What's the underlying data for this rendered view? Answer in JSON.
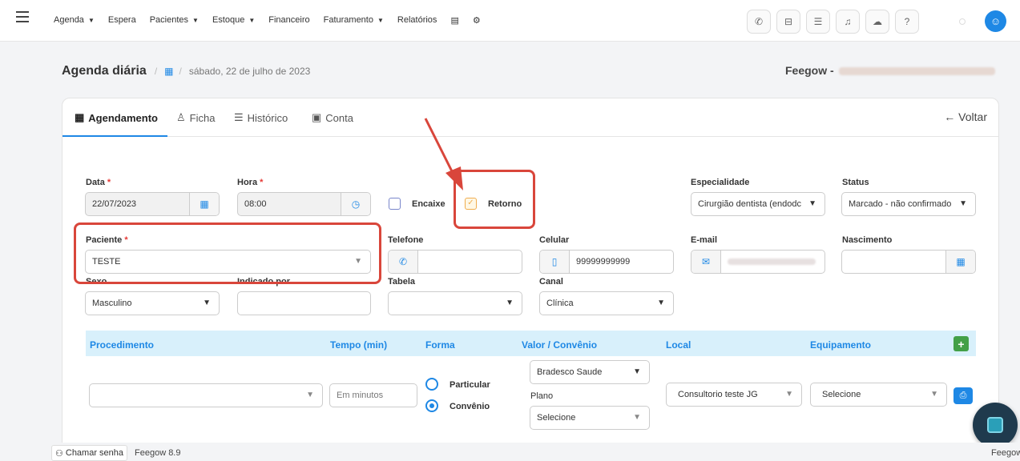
{
  "nav": {
    "items": [
      {
        "label": "Agenda",
        "caret": true
      },
      {
        "label": "Espera",
        "caret": false
      },
      {
        "label": "Pacientes",
        "caret": true
      },
      {
        "label": "Estoque",
        "caret": true
      },
      {
        "label": "Financeiro",
        "caret": false
      },
      {
        "label": "Faturamento",
        "caret": true
      },
      {
        "label": "Relatórios",
        "caret": false
      }
    ],
    "icons": [
      "database-icon",
      "gear-icon",
      "phone-icon",
      "inbox-icon",
      "checklist-icon",
      "bell-icon",
      "chat-icon",
      "help-icon",
      "user-icon"
    ]
  },
  "page": {
    "title": "Agenda diária",
    "date": "sábado, 22 de julho de 2023",
    "brand": "Feegow -"
  },
  "tabs": {
    "agendamento": "Agendamento",
    "ficha": "Ficha",
    "historico": "Histórico",
    "conta": "Conta",
    "voltar": "← Voltar"
  },
  "form": {
    "data_label": "Data",
    "data_value": "22/07/2023",
    "hora_label": "Hora",
    "hora_value": "08:00",
    "encaixe_label": "Encaixe",
    "retorno_label": "Retorno",
    "especialidade_label": "Especialidade",
    "especialidade_value": "Cirurgião dentista (endodc",
    "status_label": "Status",
    "status_value": "Marcado - não confirmado",
    "paciente_label": "Paciente",
    "paciente_value": "TESTE",
    "telefone_label": "Telefone",
    "telefone_value": "",
    "celular_label": "Celular",
    "celular_value": "99999999999",
    "email_label": "E-mail",
    "nascimento_label": "Nascimento",
    "sexo_label": "Sexo",
    "sexo_value": "Masculino",
    "indicado_label": "Indicado por",
    "tabela_label": "Tabela",
    "canal_label": "Canal",
    "canal_value": "Clínica"
  },
  "proc": {
    "headers": {
      "procedimento": "Procedimento",
      "tempo": "Tempo (min)",
      "forma": "Forma",
      "valor": "Valor / Convênio",
      "local": "Local",
      "equipamento": "Equipamento"
    },
    "tempo_placeholder": "Em minutos",
    "particular": "Particular",
    "convenio": "Convênio",
    "convenio_value": "Bradesco Saude",
    "plano_label": "Plano",
    "plano_value": "Selecione",
    "local_value": "Consultorio teste JG",
    "equip_value": "Selecione"
  },
  "footer": {
    "chamar": "Chamar senha",
    "version": "Feegow 8.9",
    "right": "Feegow"
  },
  "colors": {
    "accent": "#1e88e5",
    "highlight": "#d9463b",
    "table_header_bg": "#d8f0fb"
  }
}
